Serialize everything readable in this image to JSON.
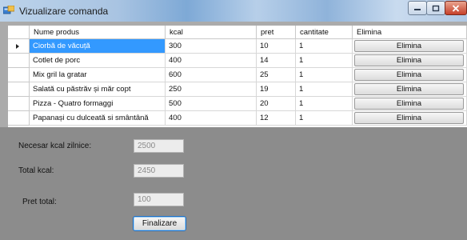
{
  "window": {
    "title": "Vizualizare comanda"
  },
  "grid": {
    "columns": [
      "Nume produs",
      "kcal",
      "pret",
      "cantitate",
      "Elimina"
    ],
    "rows": [
      {
        "name": "Ciorbă de văcuță",
        "kcal": "300",
        "pret": "10",
        "cantitate": "1",
        "action": "Elimina"
      },
      {
        "name": "Cotlet de porc",
        "kcal": "400",
        "pret": "14",
        "cantitate": "1",
        "action": "Elimina"
      },
      {
        "name": "Mix gril la gratar",
        "kcal": "600",
        "pret": "25",
        "cantitate": "1",
        "action": "Elimina"
      },
      {
        "name": "Salată cu păstrăv și măr copt",
        "kcal": "250",
        "pret": "19",
        "cantitate": "1",
        "action": "Elimina"
      },
      {
        "name": "Pizza - Quatro formaggi",
        "kcal": "500",
        "pret": "20",
        "cantitate": "1",
        "action": "Elimina"
      },
      {
        "name": "Papanași cu dulceată si smântână",
        "kcal": "400",
        "pret": "12",
        "cantitate": "1",
        "action": "Elimina"
      }
    ]
  },
  "form": {
    "necesar_label": "Necesar kcal zilnice:",
    "necesar_value": "2500",
    "total_kcal_label": "Total kcal:",
    "total_kcal_value": "2450",
    "pret_total_label": "Pret total:",
    "pret_total_value": "100",
    "finalize_label": "Finalizare"
  }
}
